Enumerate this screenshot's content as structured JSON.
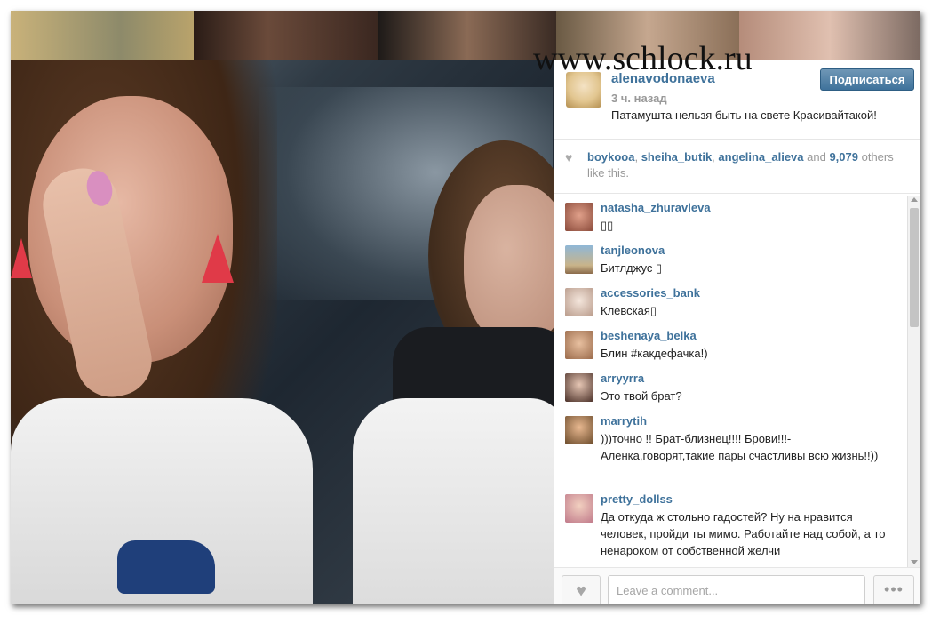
{
  "watermark": "www.schlock.ru",
  "post": {
    "username": "alenavodonaeva",
    "time": "3 ч. назад",
    "caption": "Патамушта нельзя быть на свете Красивайтакой!",
    "follow_label": "Подписаться"
  },
  "likes": {
    "users": [
      "boykooa",
      "sheiha_butik",
      "angelina_alieva"
    ],
    "sep1": ", ",
    "sep2": ", ",
    "and_text": " and ",
    "count": "9,079",
    "tail": " others like this."
  },
  "comments": [
    {
      "user": "natasha_zhuravleva",
      "text": "▯▯"
    },
    {
      "user": "tanjleonova",
      "text": "Битлджус ▯"
    },
    {
      "user": "accessories_bank",
      "text": "Клевская▯"
    },
    {
      "user": "beshenaya_belka",
      "text": "Блин #какдефачка!)"
    },
    {
      "user": "arryyrra",
      "text": "Это твой брат?"
    },
    {
      "user": "marrytih",
      "text": ")))точно !! Брат-близнец!!!! Брови!!!- Аленка,говорят,такие пары счастливы всю жизнь!!))"
    },
    {
      "user": "pretty_dollss",
      "text": "Да откуда ж стольно гадостей? Ну на нравится человек, пройди ты мимо. Работайте над собой, а то ненароком от собственной желчи"
    }
  ],
  "footer": {
    "comment_placeholder": "Leave a comment...",
    "heart_icon": "heart-icon",
    "more_icon": "•••"
  },
  "colors": {
    "link_blue": "#3f729b",
    "follow_btn": "#3f729b",
    "muted": "#999999"
  }
}
